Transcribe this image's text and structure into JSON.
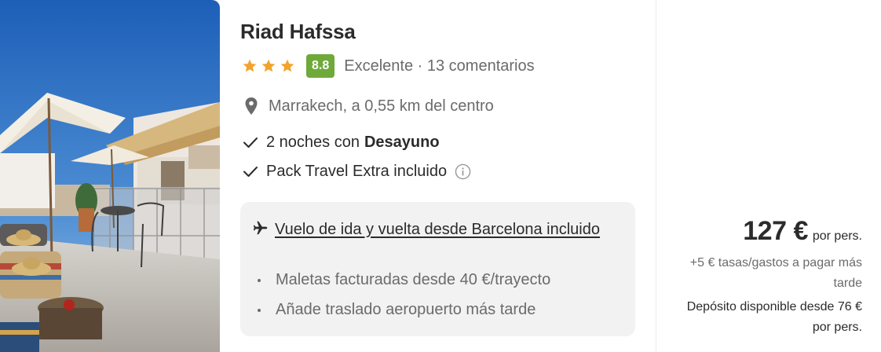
{
  "hotel": {
    "name": "Riad Hafssa",
    "stars": 3,
    "score": "8.8",
    "rating_text": "Excelente · 13 comentarios",
    "location": "Marrakech, a 0,55 km del centro"
  },
  "includes": {
    "nights_prefix": "2 noches con",
    "nights_bold": "Desayuno",
    "pack": "Pack Travel Extra incluido"
  },
  "flight": {
    "link": "Vuelo de ida y vuelta desde Barcelona incluido",
    "bullets": [
      "Maletas facturadas desde 40 €/trayecto",
      "Añade traslado aeropuerto más tarde"
    ]
  },
  "price": {
    "amount": "127 €",
    "per": "por pers.",
    "fees": "+5 € tasas/gastos a pagar más tarde",
    "deposit": "Depósito disponible desde 76 € por pers."
  },
  "icons": {
    "star": "star-icon",
    "pin": "location-pin-icon",
    "check": "check-icon",
    "info": "info-icon",
    "plane": "plane-icon"
  },
  "colors": {
    "score_badge": "#6ea93a",
    "star": "#f3a32b",
    "box_bg": "#f2f2f2",
    "muted_text": "#6b6b6b"
  }
}
